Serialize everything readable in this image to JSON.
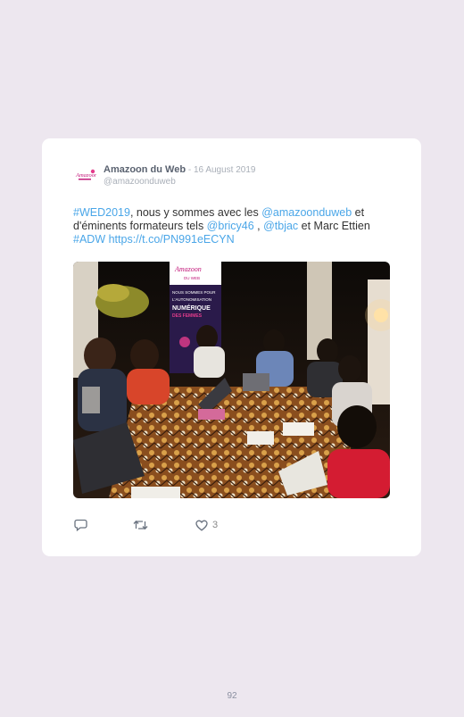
{
  "tweet": {
    "author_name": "Amazoon du Web",
    "separator": " - ",
    "date": "16 August 2019",
    "handle": "@amazoonduweb",
    "text_parts": [
      {
        "text": "#WED2019",
        "type": "link"
      },
      {
        "text": ", nous y sommes avec les ",
        "type": "text"
      },
      {
        "text": "@amazoonduweb",
        "type": "link"
      },
      {
        "text": " et d'éminents formateurs tels ",
        "type": "text"
      },
      {
        "text": "@bricy46",
        "type": "link"
      },
      {
        "text": " , ",
        "type": "text"
      },
      {
        "text": "@tbjac",
        "type": "link"
      },
      {
        "text": " et Marc Ettien ",
        "type": "text"
      },
      {
        "text": "#ADW",
        "type": "link"
      },
      {
        "text": " ",
        "type": "text"
      },
      {
        "text": "https://t.co/PN991eECYN",
        "type": "link"
      }
    ],
    "like_count": "3",
    "photo_banner": {
      "logo_line1": "Amazoon",
      "logo_line2": "DU WEB",
      "line1": "NOUS SOMMES POUR",
      "line2": "L'AUTONOMISATION",
      "line3": "NUMÉRIQUE",
      "line4": "DES FEMMES"
    }
  },
  "icons": {
    "reply": "reply-icon",
    "retweet": "retweet-icon",
    "like": "heart-icon",
    "avatar_logo": "amazoon-logo-icon"
  },
  "colors": {
    "link": "#4aa6e8",
    "background": "#ede7ef",
    "card": "#ffffff",
    "brand_pink": "#c2187a"
  },
  "page_number": "92"
}
